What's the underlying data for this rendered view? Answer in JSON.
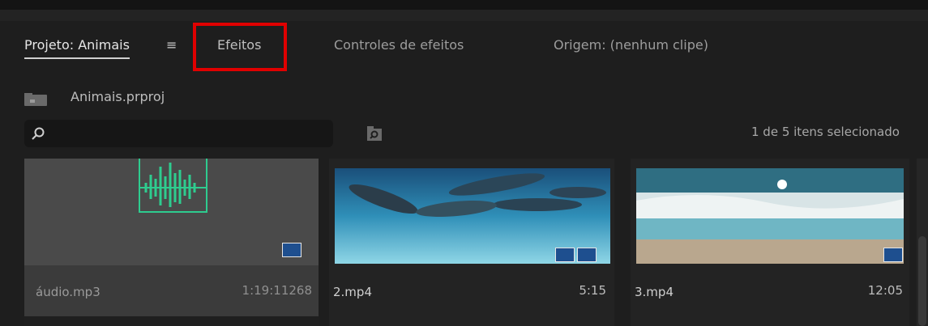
{
  "tabs": {
    "project_label": "Projeto: Animais",
    "menu_glyph": "≡",
    "effects_label": "Efeitos",
    "effect_controls_label": "Controles de efeitos",
    "source_label": "Origem: (nenhum clipe)"
  },
  "breadcrumb": {
    "project_file": "Animais.prproj",
    "icon": "project-folder-icon"
  },
  "search": {
    "value": "",
    "placeholder": "",
    "icon": "search-icon"
  },
  "bin_search": {
    "icon": "find-in-bin-icon"
  },
  "status": {
    "selection": "1 de 5 itens selecionado"
  },
  "clips": [
    {
      "name": "áudio.mp3",
      "duration": "1:19:11268",
      "type": "audio",
      "badges": [
        "audio-badge-icon"
      ]
    },
    {
      "name": "2.mp4",
      "duration": "5:15",
      "type": "video",
      "badges": [
        "video-badge-icon",
        "audio-badge-icon"
      ]
    },
    {
      "name": "3.mp4",
      "duration": "12:05",
      "type": "video",
      "badges": [
        "video-badge-icon"
      ]
    }
  ],
  "colors": {
    "highlight": "#e00000",
    "badge": "#1e4f8f",
    "waveform": "#2ecc8f",
    "panel_bg": "#1e1e1e",
    "selected_card": "#3b3b3b"
  }
}
